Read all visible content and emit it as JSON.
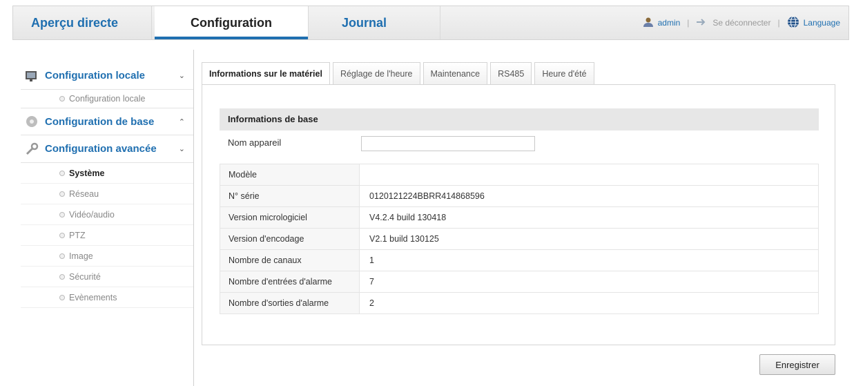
{
  "nav": {
    "tabs": [
      "Aperçu directe",
      "Configuration",
      "Journal"
    ],
    "active_tab": "Configuration",
    "user": "admin",
    "logout": "Se déconnecter",
    "language": "Language"
  },
  "sidebar": {
    "groups": [
      {
        "label": "Configuration locale",
        "icon": "monitor-icon",
        "chevron": "down",
        "items": [
          "Configuration locale"
        ]
      },
      {
        "label": "Configuration de base",
        "icon": "disc-icon",
        "chevron": "up",
        "items": []
      },
      {
        "label": "Configuration avancée",
        "icon": "wrench-icon",
        "chevron": "down",
        "items": [
          "Système",
          "Réseau",
          "Vidéo/audio",
          "PTZ",
          "Image",
          "Sécurité",
          "Evènements"
        ]
      }
    ],
    "active_item": "Système"
  },
  "tabs": [
    "Informations sur le matériel",
    "Réglage de l'heure",
    "Maintenance",
    "RS485",
    "Heure d'été"
  ],
  "active_tab": "Informations sur le matériel",
  "section": {
    "title": "Informations de base",
    "name_label": "Nom appareil",
    "name_value": ""
  },
  "info_rows": [
    {
      "label": "Modèle",
      "value": ""
    },
    {
      "label": "N° série",
      "value": "0120121224BBRR414868596"
    },
    {
      "label": "Version micrologiciel",
      "value": "V4.2.4 build 130418"
    },
    {
      "label": "Version d'encodage",
      "value": "V2.1 build 130125"
    },
    {
      "label": "Nombre de canaux",
      "value": "1"
    },
    {
      "label": "Nombre d'entrées d'alarme",
      "value": "7"
    },
    {
      "label": "Nombre d'sorties d'alarme",
      "value": "2"
    }
  ],
  "save_label": "Enregistrer",
  "colors": {
    "accent": "#1f6fb0",
    "section_bg": "#e7e7e7"
  }
}
